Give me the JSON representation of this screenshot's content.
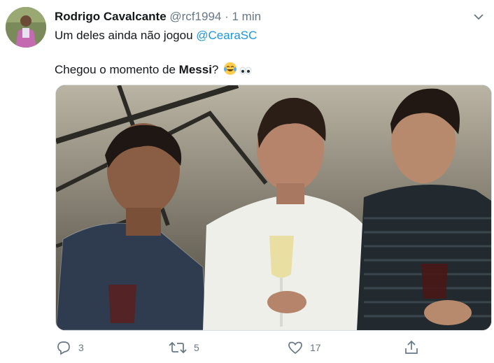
{
  "tweet": {
    "author_name": "Rodrigo Cavalcante",
    "author_handle": "@rcf1994",
    "separator": "·",
    "time": "1 min",
    "text_line1": "Um deles ainda não jogou ",
    "mention": "@CearaSC",
    "text_line2_prefix": "Chegou o momento de ",
    "text_line2_bold": "Messi",
    "text_line2_suffix": "?",
    "emoji": "tears-of-joy-emoji eyes-emoji"
  },
  "actions": {
    "reply_count": "3",
    "retweet_count": "5",
    "like_count": "17"
  },
  "icons": {
    "avatar": "avatar-photo",
    "caret": "chevron-down-icon",
    "reply": "reply-icon",
    "retweet": "retweet-icon",
    "like": "heart-icon",
    "share": "share-icon"
  },
  "colors": {
    "link": "#1b95e0",
    "muted": "#657786",
    "text": "#14171a"
  }
}
